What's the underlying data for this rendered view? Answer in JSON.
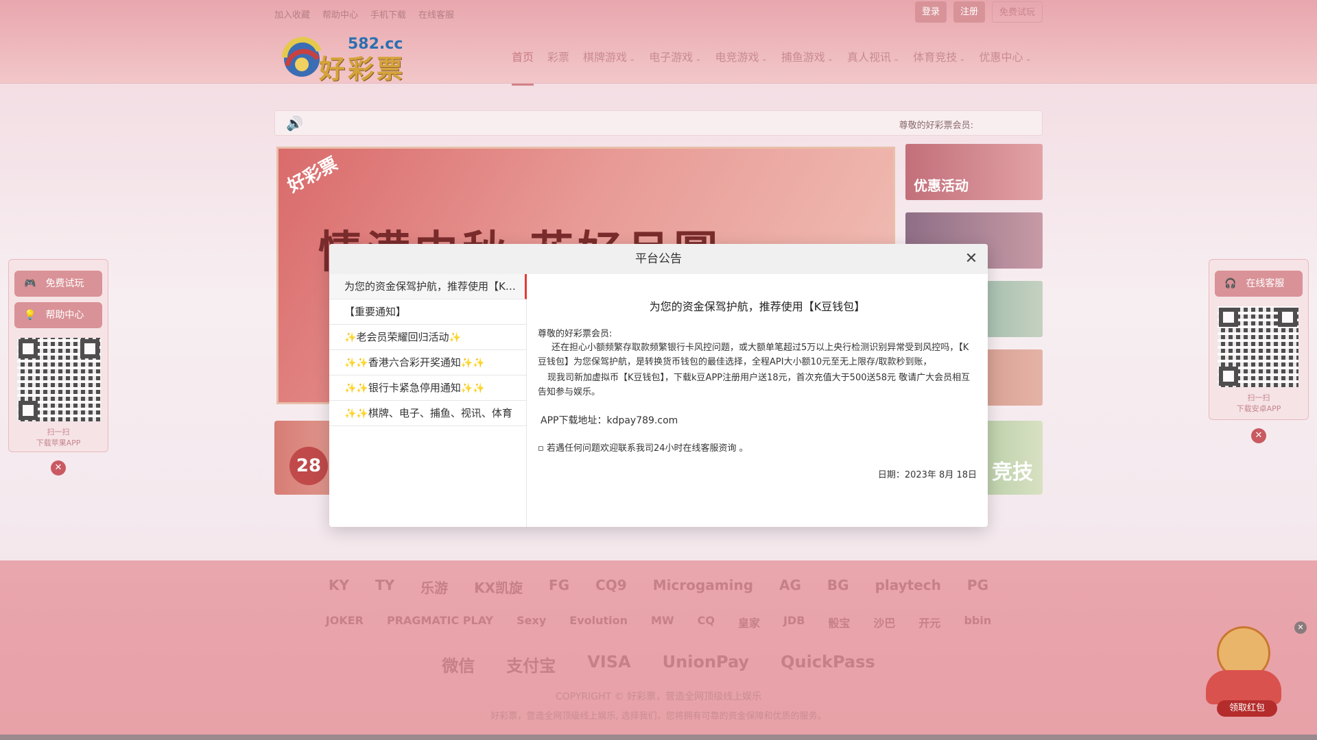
{
  "topbar": {
    "links": [
      "加入收藏",
      "帮助中心",
      "手机下载",
      "在线客服"
    ],
    "login": "登录",
    "register": "注册",
    "trial": "免费试玩"
  },
  "logo": {
    "domain": "582.cc",
    "name": "好彩票"
  },
  "nav": {
    "items": [
      {
        "label": "首页",
        "dropdown": false
      },
      {
        "label": "彩票",
        "dropdown": false
      },
      {
        "label": "棋牌游戏",
        "dropdown": true
      },
      {
        "label": "电子游戏",
        "dropdown": true
      },
      {
        "label": "电竞游戏",
        "dropdown": true
      },
      {
        "label": "捕鱼游戏",
        "dropdown": true
      },
      {
        "label": "真人视讯",
        "dropdown": true
      },
      {
        "label": "体育竞技",
        "dropdown": true
      },
      {
        "label": "优惠中心",
        "dropdown": true
      }
    ]
  },
  "ticker": {
    "text": "尊敬的好彩票会员:"
  },
  "banner": {
    "tag": "好彩票",
    "title": "情满中秋 花好月圆"
  },
  "sidecards": {
    "promo": "优惠活动"
  },
  "bottomcards": {
    "ball": "28",
    "sport": "竞技"
  },
  "float_left": {
    "trial": "免费试玩",
    "help": "帮助中心",
    "caption1": "扫一扫",
    "caption2": "下载苹果APP"
  },
  "float_right": {
    "service": "在线客服",
    "caption1": "扫一扫",
    "caption2": "下载安卓APP"
  },
  "footer": {
    "providers_row1": [
      "KY",
      "TY",
      "乐游",
      "KX凯旋",
      "FG",
      "CQ9",
      "Microgaming",
      "AG",
      "BG",
      "playtech",
      "PG"
    ],
    "providers_row2": [
      "JOKER",
      "PRAGMATIC PLAY",
      "Sexy",
      "Evolution",
      "MW",
      "CQ",
      "皇家",
      "JDB",
      "骰宝",
      "沙巴",
      "开元",
      "bbin"
    ],
    "payments": [
      "微信",
      "支付宝",
      "VISA",
      "UnionPay",
      "QuickPass"
    ],
    "copyright": "COPYRIGHT © 好彩票，营造全网顶级线上娱乐",
    "slogan": "好彩票，营造全网顶级线上娱乐, 选择我们，您将拥有可靠的资金保障和优质的服务。"
  },
  "mascot": {
    "button": "领取红包"
  },
  "modal": {
    "title": "平台公告",
    "menu": [
      {
        "label": "为您的资金保驾护航，推荐使用【K豆钱包】",
        "sparkles": false,
        "active": true
      },
      {
        "label": "【重要通知】",
        "sparkles": false,
        "active": false
      },
      {
        "label": "老会员荣耀回归活动",
        "sparkles": true,
        "active": false
      },
      {
        "label": "香港六合彩开奖通知",
        "sparkles": true,
        "active": false
      },
      {
        "label": "银行卡紧急停用通知",
        "sparkles": true,
        "active": false
      },
      {
        "label": "棋牌、电子、捕鱼、视讯、体育",
        "sparkles": true,
        "active": false
      }
    ],
    "content": {
      "heading": "为您的资金保驾护航，推荐使用【K豆钱包】",
      "greeting": "尊敬的好彩票会员:",
      "p1": "还在担心小额频繁存取款频繁银行卡风控问题，或大额单笔超过5万以上央行检测识别异常受到风控吗，【K豆钱包】为您保驾护航，是转换货币钱包的最佳选择，全程API大小额10元至无上限存/取款秒到账，",
      "p2": "现我司新加虚拟币【K豆钱包】，下载k豆APP注册用户送18元，首次充值大于500送58元 敬请广大会员相互告知参与娱乐。",
      "app": "APP下载地址：kdpay789.com",
      "help": "▫ 若遇任何问题欢迎联系我司24小时在线客服资询 。",
      "date": "日期：2023年 8月 18日"
    }
  },
  "colors": {
    "accent": "#e53935",
    "header_bg": "#e8a6ad"
  }
}
